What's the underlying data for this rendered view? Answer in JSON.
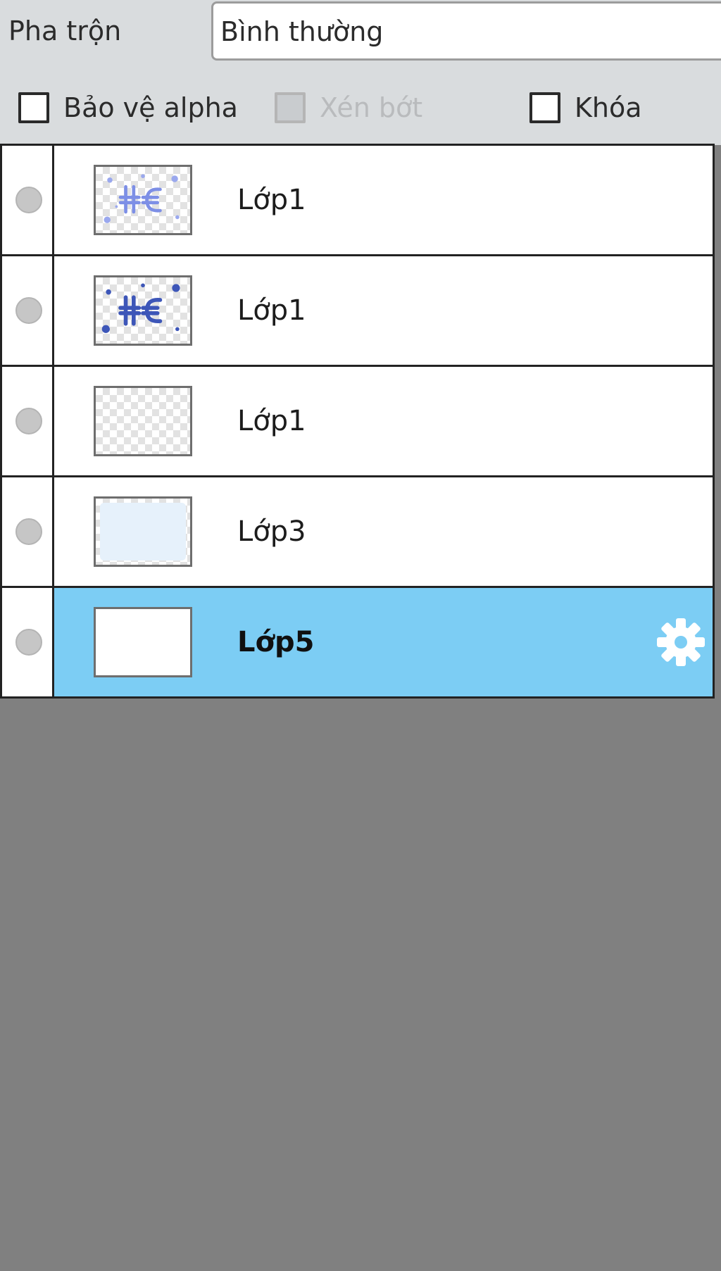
{
  "blend": {
    "label": "Pha trộn",
    "value": "Bình thường"
  },
  "options": {
    "protect_alpha": {
      "label": "Bảo vệ alpha",
      "checked": false,
      "enabled": true
    },
    "clip": {
      "label": "Xén bớt",
      "checked": false,
      "enabled": false
    },
    "lock": {
      "label": "Khóa",
      "checked": false,
      "enabled": true
    }
  },
  "layers": [
    {
      "name": "Lớp1",
      "thumbnail": "text-art-light",
      "selected": false
    },
    {
      "name": "Lớp1",
      "thumbnail": "text-art-dark",
      "selected": false
    },
    {
      "name": "Lớp1",
      "thumbnail": "transparent",
      "selected": false
    },
    {
      "name": "Lớp3",
      "thumbnail": "light-blue-fill",
      "selected": false
    },
    {
      "name": "Lớp5",
      "thumbnail": "white",
      "selected": true
    }
  ],
  "icons": {
    "selected_layer_action": "gear-icon",
    "visibility": "visibility-dot-icon"
  },
  "colors": {
    "selection": "#7ccdf4",
    "panel": "#d9dcde",
    "empty_area": "#808080"
  }
}
